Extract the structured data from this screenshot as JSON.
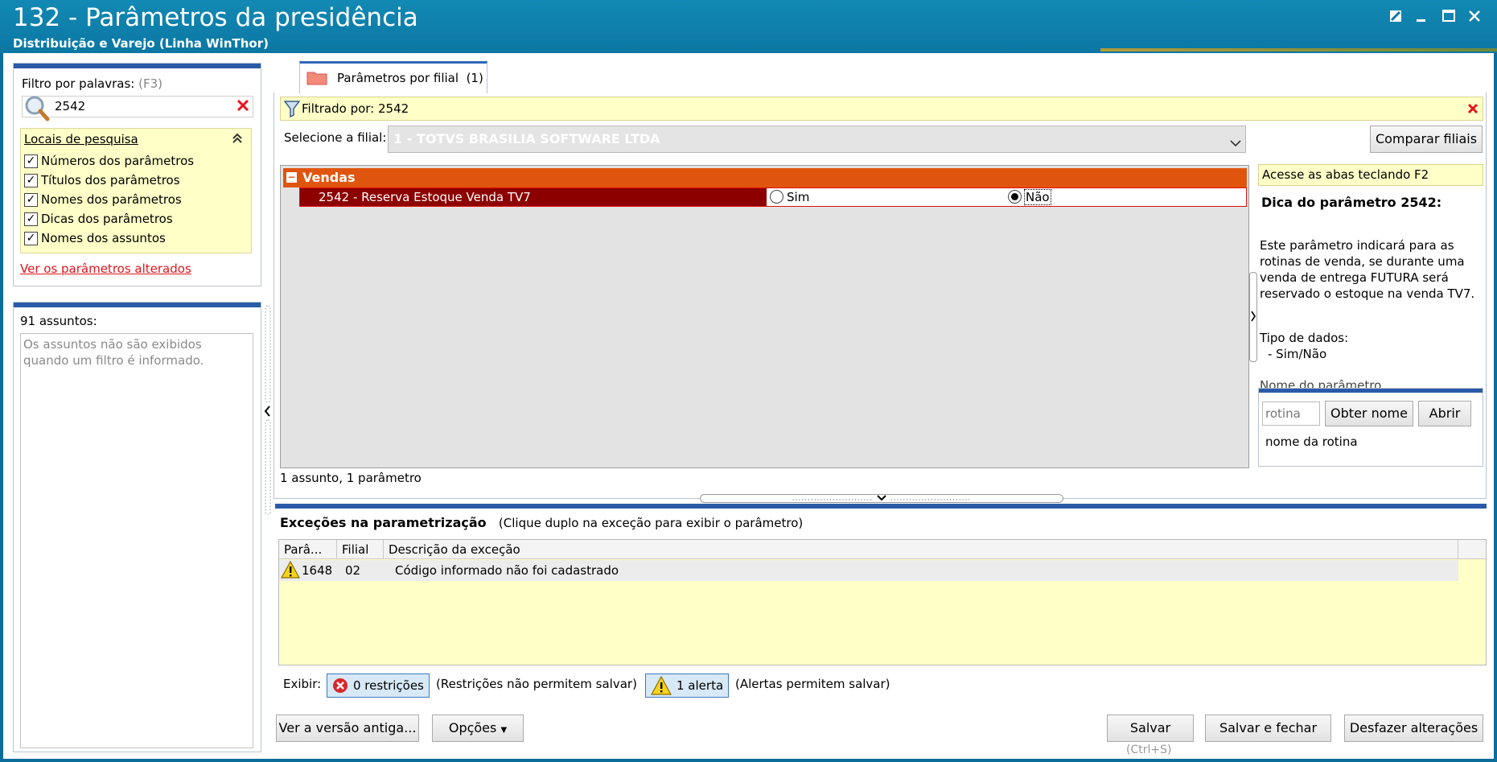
{
  "window": {
    "title": "132 - Parâmetros da presidência",
    "subtitle": "Distribuição e Varejo (Linha WinThor)",
    "controls": [
      "restore-icon",
      "minimize-icon",
      "maximize-icon",
      "close-icon"
    ]
  },
  "filter": {
    "label": "Filtro por palavras:",
    "hotkey": "(F3)",
    "value": "2542",
    "locais_title": "Locais de pesquisa",
    "options": [
      {
        "label": "Números dos parâmetros",
        "checked": true
      },
      {
        "label": "Títulos dos parâmetros",
        "checked": true
      },
      {
        "label": "Nomes dos parâmetros",
        "checked": true
      },
      {
        "label": "Dicas dos parâmetros",
        "checked": true
      },
      {
        "label": "Nomes dos assuntos",
        "checked": true
      }
    ],
    "changed_link": "Ver os parâmetros alterados"
  },
  "assuntos": {
    "count_label": "91 assuntos:",
    "message": "Os assuntos não são exibidos quando um filtro é informado."
  },
  "tab": {
    "label": "Parâmetros por filial",
    "count": "(1)"
  },
  "filtered_by": "Filtrado por: 2542",
  "filial": {
    "label": "Selecione a filial:",
    "value": "1 - TOTVS BRASILIA SOFTWARE LTDA",
    "compare_button": "Comparar filiais"
  },
  "grid": {
    "group": "Vendas",
    "param": "2542 - Reserva Estoque Venda TV7",
    "option_yes": "Sim",
    "option_no": "Não",
    "selected": "Não"
  },
  "status": "1 assunto, 1 parâmetro",
  "hint": {
    "hotkey": "Acesse as abas teclando F2",
    "title": "Dica do parâmetro 2542:",
    "body": "Este parâmetro indicará para as rotinas de venda, se durante uma venda de entrega FUTURA será reservado o estoque na venda TV7.",
    "tipo_label": "Tipo de dados:",
    "tipo_value": "- Sim/Não",
    "fade": "Nome do parâmetro"
  },
  "rotina": {
    "placeholder": "rotina",
    "obter_button": "Obter nome",
    "abrir_button": "Abrir",
    "name_label": "nome da rotina"
  },
  "exceptions": {
    "title": "Exceções na parametrização",
    "hint": "(Clique duplo na exceção para exibir o parâmetro)",
    "columns": [
      "Parâ...",
      "Filial",
      "Descrição da exceção"
    ],
    "rows": [
      {
        "param": "1648",
        "filial": "02",
        "descricao": "Código informado não foi cadastrado"
      }
    ]
  },
  "exibir": {
    "label": "Exibir:",
    "restricoes": "0 restrições",
    "restricoes_note": "(Restrições não permitem salvar)",
    "alertas": "1 alerta",
    "alertas_note": "(Alertas permitem salvar)"
  },
  "buttons": {
    "old_version": "Ver a versão antiga...",
    "options": "Opções",
    "save": "Salvar",
    "save_shortcut": "(Ctrl+S)",
    "save_close": "Salvar e fechar",
    "undo": "Desfazer alterações"
  },
  "colors": {
    "titlebar": "#0b77a3",
    "group_header": "#e0550d",
    "selected_row": "#8c0000",
    "hint_yellow": "#ffffc8",
    "panel_bar": "#2a5ba8"
  }
}
